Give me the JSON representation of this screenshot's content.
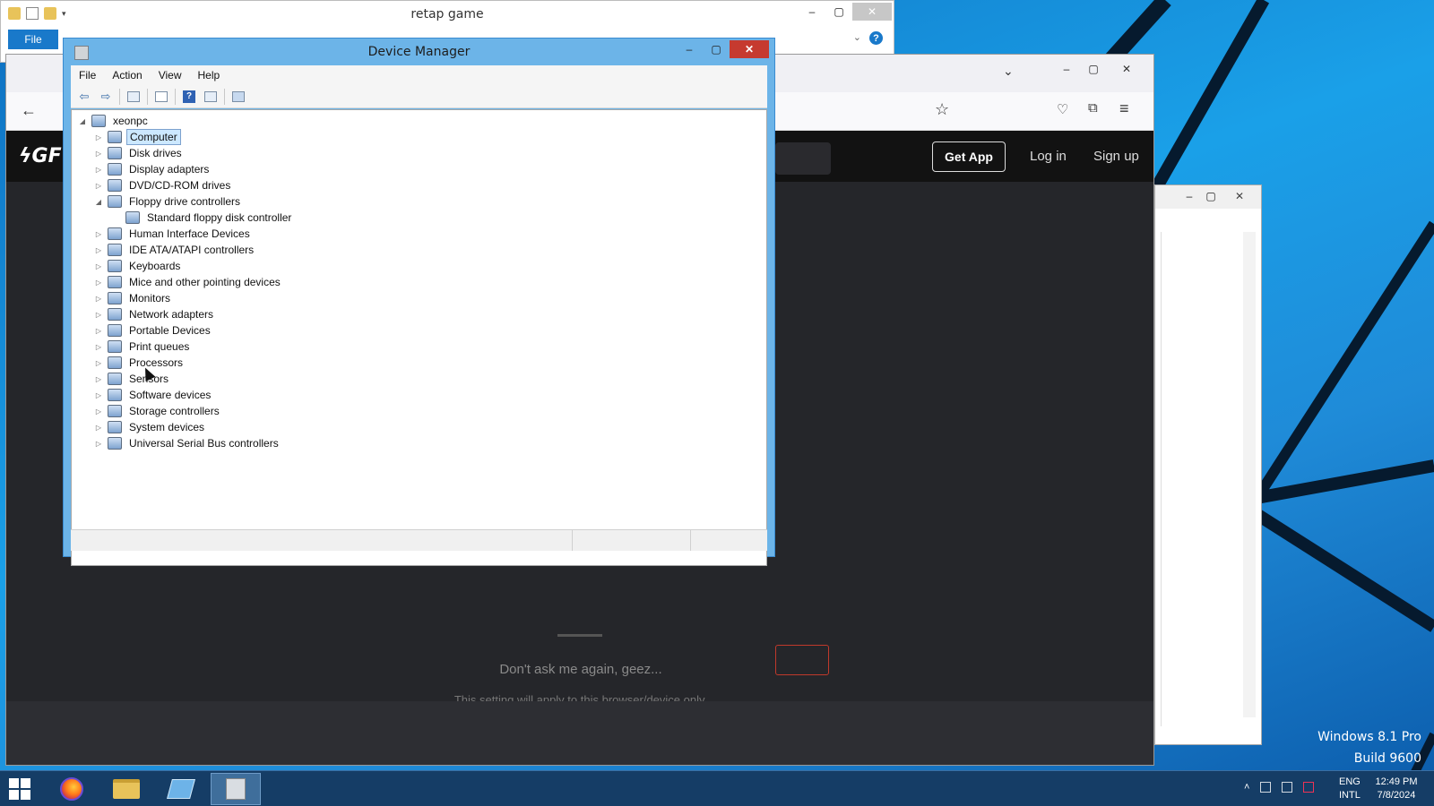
{
  "desktop": {
    "edition": "Windows 8.1 Pro",
    "build": "Build 9600"
  },
  "explorer": {
    "title": "retap game",
    "file_tab": "File",
    "help": "?"
  },
  "browser": {
    "get_app": "Get App",
    "login": "Log in",
    "signup": "Sign up",
    "dont_ask": "Don't ask me again, geez...",
    "setting_note": "This setting will apply to this browser/device only.",
    "logo": "GF"
  },
  "device_manager": {
    "title": "Device Manager",
    "menu": [
      "File",
      "Action",
      "View",
      "Help"
    ],
    "root": "xeonpc",
    "items": [
      {
        "label": "Computer",
        "expander": "▷",
        "selected": true
      },
      {
        "label": "Disk drives",
        "expander": "▷"
      },
      {
        "label": "Display adapters",
        "expander": "▷"
      },
      {
        "label": "DVD/CD-ROM drives",
        "expander": "▷"
      },
      {
        "label": "Floppy drive controllers",
        "expander": "◢"
      },
      {
        "label": "Standard floppy disk controller",
        "expander": "",
        "child": true
      },
      {
        "label": "Human Interface Devices",
        "expander": "▷"
      },
      {
        "label": "IDE ATA/ATAPI controllers",
        "expander": "▷"
      },
      {
        "label": "Keyboards",
        "expander": "▷"
      },
      {
        "label": "Mice and other pointing devices",
        "expander": "▷"
      },
      {
        "label": "Monitors",
        "expander": "▷"
      },
      {
        "label": "Network adapters",
        "expander": "▷"
      },
      {
        "label": "Portable Devices",
        "expander": "▷"
      },
      {
        "label": "Print queues",
        "expander": "▷"
      },
      {
        "label": "Processors",
        "expander": "▷"
      },
      {
        "label": "Sensors",
        "expander": "▷"
      },
      {
        "label": "Software devices",
        "expander": "▷"
      },
      {
        "label": "Storage controllers",
        "expander": "▷"
      },
      {
        "label": "System devices",
        "expander": "▷"
      },
      {
        "label": "Universal Serial Bus controllers",
        "expander": "▷"
      }
    ]
  },
  "taskbar": {
    "lang_top": "ENG",
    "lang_bottom": "INTL",
    "time": "12:49 PM",
    "date": "7/8/2024"
  }
}
